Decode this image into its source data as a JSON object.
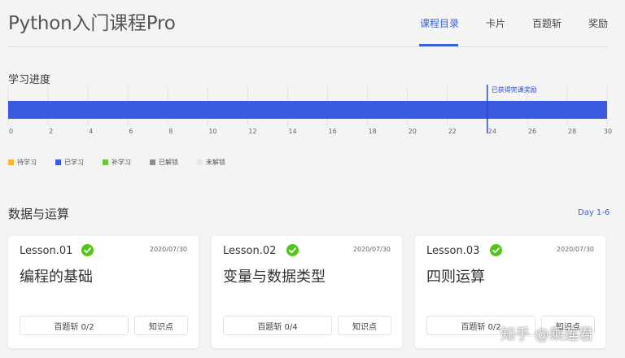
{
  "header": {
    "title": "Python入门课程Pro",
    "tabs": [
      {
        "label": "课程目录",
        "active": true
      },
      {
        "label": "卡片",
        "active": false
      },
      {
        "label": "百题斩",
        "active": false
      },
      {
        "label": "奖励",
        "active": false
      }
    ]
  },
  "progress": {
    "section_title": "学习进度",
    "reward_marker_label": "已获得完课奖励",
    "reward_day": 24,
    "learned_days": 30,
    "colors": {
      "pending": "#f5b733",
      "learned": "#3a5be0",
      "makeup": "#74c043",
      "unlocked": "#8c8c8c",
      "locked": "#e6e6e6",
      "marker": "#2d4cc8"
    }
  },
  "chart_data": {
    "type": "bar",
    "orientation": "horizontal",
    "x_ticks": [
      "0",
      "2",
      "4",
      "6",
      "8",
      "10",
      "12",
      "14",
      "16",
      "18",
      "20",
      "22",
      "24",
      "26",
      "28",
      "30"
    ],
    "xlim": [
      0,
      30
    ],
    "series": [
      {
        "name": "已学习",
        "values": [
          30
        ]
      }
    ],
    "legend": [
      "待学习",
      "已学习",
      "补学习",
      "已解锁",
      "未解锁"
    ],
    "legend_placement": "bottom-left",
    "annotations": [
      {
        "x": 24,
        "text": "已获得完课奖励"
      }
    ],
    "grid": true
  },
  "unit": {
    "title": "数据与运算",
    "day_range": "Day 1-6"
  },
  "lessons": [
    {
      "number": "Lesson.01",
      "date": "2020/07/30",
      "name": "编程的基础",
      "quiz": "百题斩 0/2",
      "knowledge": "知识点"
    },
    {
      "number": "Lesson.02",
      "date": "2020/07/30",
      "name": "变量与数据类型",
      "quiz": "百题斩 0/4",
      "knowledge": "知识点"
    },
    {
      "number": "Lesson.03",
      "date": "2020/07/30",
      "name": "四则运算",
      "quiz": "百题斩 0/2",
      "knowledge": "知识点"
    }
  ],
  "watermark": "知乎 @乘莲君"
}
